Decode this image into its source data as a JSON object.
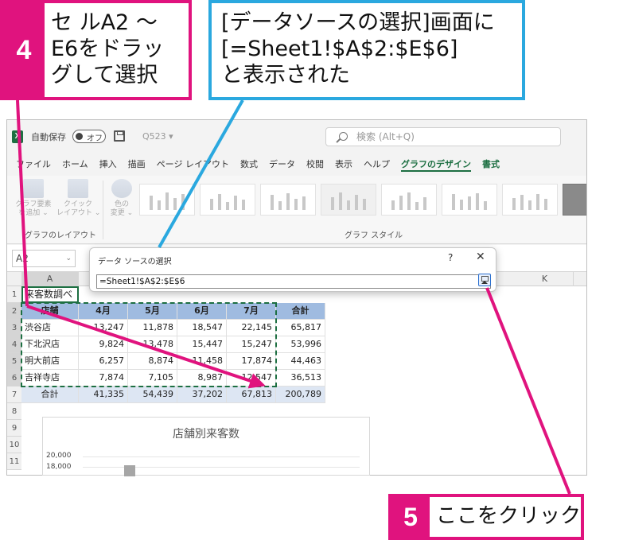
{
  "callouts": {
    "step4": {
      "number": "4",
      "text": "セ ルA2 ～\nE6をドラッ\nグして選択"
    },
    "step_info": {
      "text": "[データソースの選択]画面に\n[=Sheet1!$A$2:$E$6]\nと表示された"
    },
    "step5": {
      "number": "5",
      "text": "ここをクリック"
    }
  },
  "titlebar": {
    "autosave": "自動保存",
    "toggle_state": "オフ",
    "file_name": "Q523 ▾",
    "search_placeholder": "検索 (Alt+Q)"
  },
  "menu": [
    "ファイル",
    "ホーム",
    "挿入",
    "描画",
    "ページ レイアウト",
    "数式",
    "データ",
    "校閲",
    "表示",
    "ヘルプ",
    "グラフのデザイン",
    "書式"
  ],
  "ribbon": {
    "add_element": "グラフ要素\nを追加 ⌄",
    "quick_layout": "クイック\nレイアウト ⌄",
    "change_color": "色の\n変更 ⌄",
    "layout_group": "グラフのレイアウト",
    "style_group": "グラフ スタイル"
  },
  "formula_bar": {
    "name_box": "A2"
  },
  "dialog": {
    "title": "データ ソースの選択",
    "help": "?",
    "close": "✕",
    "range": "=Sheet1!$A$2:$E$6"
  },
  "sheet": {
    "columns": [
      "A",
      "K"
    ],
    "rows": [
      "1",
      "2",
      "3",
      "4",
      "5",
      "6",
      "7",
      "8",
      "9",
      "10",
      "11"
    ],
    "title": "来客数調べ",
    "headers": [
      "店舗",
      "4月",
      "5月",
      "6月",
      "7月",
      "合計"
    ],
    "data": [
      [
        "渋谷店",
        "13,247",
        "11,878",
        "18,547",
        "22,145",
        "65,817"
      ],
      [
        "下北沢店",
        "9,824",
        "13,478",
        "15,447",
        "15,247",
        "53,996"
      ],
      [
        "明大前店",
        "6,257",
        "8,874",
        "11,458",
        "17,874",
        "44,463"
      ],
      [
        "吉祥寺店",
        "7,874",
        "7,105",
        "8,987",
        "12,547",
        "36,513"
      ]
    ],
    "total": [
      "合計",
      "41,335",
      "54,439",
      "37,202",
      "67,813",
      "200,789"
    ]
  },
  "chart": {
    "title": "店舗別来客数",
    "ticks": [
      "20,000",
      "18,000"
    ]
  },
  "colors": {
    "pink": "#e0137e",
    "blue": "#2aa8df",
    "excel_green": "#1d6f42"
  }
}
